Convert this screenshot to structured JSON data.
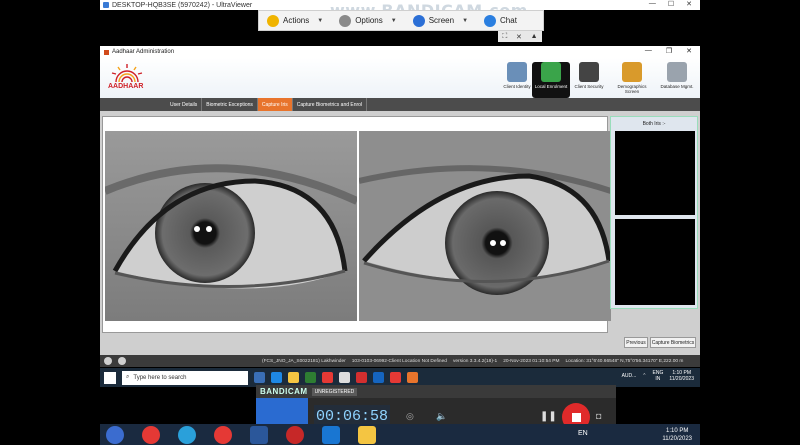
{
  "uv": {
    "title": "DESKTOP-HQB3SE (5970242) - UltraViewer",
    "ctrl_min": "—",
    "ctrl_max": "☐",
    "ctrl_close": "✕"
  },
  "watermark": "www.BANDICAM.com",
  "toolbar": {
    "actions": "Actions",
    "options": "Options",
    "screen": "Screen",
    "chat": "Chat"
  },
  "aadhaar": {
    "window_title": "Aadhaar Administration",
    "logo_text": "AADHAAR",
    "nav": [
      {
        "label": "Client Identity"
      },
      {
        "label": "Local Enrolment"
      },
      {
        "label": "Client Security"
      },
      {
        "label": "Demographics Screen"
      },
      {
        "label": "Database Mgmt."
      }
    ],
    "tabs": [
      {
        "label": "User Details"
      },
      {
        "label": "Biometric Exceptions"
      },
      {
        "label": "Capture Iris"
      },
      {
        "label": "Capture Biometrics and Enrol"
      }
    ],
    "side_title": "Both Iris :-",
    "btn_previous": "Previous",
    "btn_capture": "Capture Biometrics"
  },
  "status": {
    "text1": "(FCS_JNO_JA_S0022181) Lakhwinder",
    "text2": "103-0103-06992-Client Location Not Defined",
    "text3": "version 3.3.4.2(18)-1",
    "text4": "20-Nov-2023 01:10:54 PM",
    "text5": "Location: 31°6'40.66548\" N,75°0'56.34170\" E,222.00 m"
  },
  "r_taskbar": {
    "search": "Type here to search",
    "weather": "AUD...",
    "lang1": "ENG",
    "lang2": "IN",
    "time": "1:10 PM",
    "date": "11/20/2023"
  },
  "bandicam": {
    "logo": "BANDICAM",
    "unreg": "UNREGISTERED",
    "timer": "00:06:58"
  },
  "l_taskbar": {
    "lang": "EN",
    "time": "1:10 PM",
    "date": "11/20/2023"
  },
  "colors": {
    "accent_tab": "#e8742c",
    "record": "#e02a2a",
    "bandicam_blue": "#2a6bd1"
  }
}
